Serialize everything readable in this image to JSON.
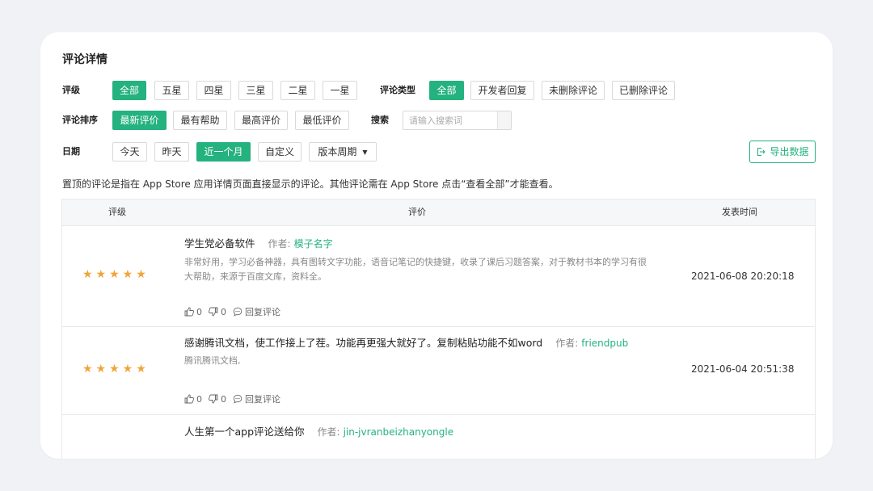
{
  "page": {
    "title": "评论详情"
  },
  "filters": {
    "rating": {
      "label": "评级",
      "options": [
        "全部",
        "五星",
        "四星",
        "三星",
        "二星",
        "一星"
      ],
      "selected": "全部"
    },
    "type": {
      "label": "评论类型",
      "options": [
        "全部",
        "开发者回复",
        "未删除评论",
        "已删除评论"
      ],
      "selected": "全部"
    },
    "sort": {
      "label": "评论排序",
      "options": [
        "最新评价",
        "最有帮助",
        "最高评价",
        "最低评价"
      ],
      "selected": "最新评价"
    },
    "search": {
      "label": "搜索",
      "placeholder": "请输入搜索词",
      "value": ""
    },
    "date": {
      "label": "日期",
      "options": [
        "今天",
        "昨天",
        "近一个月",
        "自定义"
      ],
      "selected": "近一个月",
      "dropdown": "版本周期"
    },
    "export_label": "导出数据"
  },
  "notice": "置顶的评论是指在 App Store 应用详情页面直接显示的评论。其他评论需在 App Store 点击“查看全部”才能查看。",
  "table": {
    "headers": {
      "rating": "评级",
      "review": "评价",
      "time": "发表时间"
    },
    "author_label": "作者:",
    "reply_label": "回复评论",
    "rows": [
      {
        "stars": "★★★★★",
        "title": "学生党必备软件",
        "author": "模子名字",
        "body": "非常好用，学习必备神器，具有图转文字功能，语音记笔记的快捷键，收录了课后习题答案，对于教材书本的学习有很大帮助，来源于百度文库，资料全。",
        "date": "2021-06-08 20:20:18",
        "likes": "0",
        "dislikes": "0"
      },
      {
        "stars": "★★★★★",
        "title": "感谢腾讯文档，使工作接上了茬。功能再更强大就好了。复制粘贴功能不如word",
        "author": "friendpub",
        "body": "腾讯腾讯文档,",
        "date": "2021-06-04 20:51:38",
        "likes": "0",
        "dislikes": "0"
      },
      {
        "title": "人生第一个app评论送给你",
        "author": "jin-jvranbeizhanyongle"
      }
    ]
  },
  "colors": {
    "accent": "#24b27e",
    "star": "#f0a53a",
    "background": "#f1f2f5"
  },
  "icons": [
    "export-icon",
    "thumb-up-icon",
    "thumb-down-icon",
    "comment-icon",
    "caret-down-icon"
  ]
}
